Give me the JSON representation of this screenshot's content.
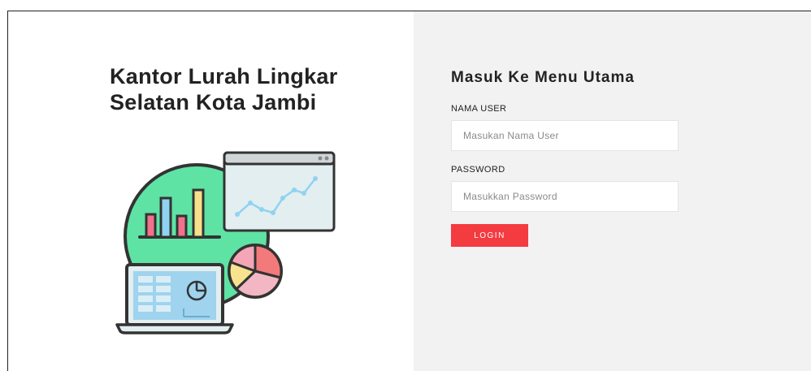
{
  "brand": {
    "title": "Kantor Lurah Lingkar Selatan Kota Jambi"
  },
  "login": {
    "heading": "Masuk Ke Menu Utama",
    "username_label": "NAMA USER",
    "username_placeholder": "Masukan Nama User",
    "username_value": "",
    "password_label": "PASSWORD",
    "password_placeholder": "Masukkan Password",
    "password_value": "",
    "submit_label": "LOGIN"
  },
  "illustration": {
    "icon": "analytics-dashboard-icon",
    "colors": {
      "circle": "#5ee3a5",
      "bar_pink": "#f1728a",
      "bar_blue": "#8fd3f0",
      "bar_yellow": "#f7e08a",
      "pie_red": "#f27a7a",
      "pie_pink": "#f4a6b6",
      "pie_yellow": "#f7e38e",
      "screen_blue": "#9fd3ee",
      "outline": "#333333"
    }
  },
  "theme": {
    "accent": "#f43b40",
    "right_panel_bg": "#f2f2f2"
  }
}
